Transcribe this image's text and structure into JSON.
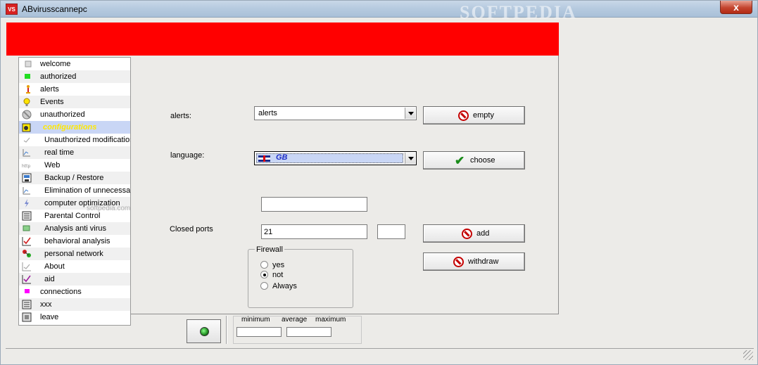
{
  "window": {
    "title": "ABvirusscannepc",
    "app_icon_text": "VS",
    "watermark": "SOFTPEDIA",
    "close_label": "x",
    "banner_color": "#ff0000"
  },
  "sidebar": {
    "items": [
      {
        "label": "welcome",
        "icon": "page-icon"
      },
      {
        "label": "authorized",
        "icon": "green-square-icon"
      },
      {
        "label": "alerts",
        "icon": "alert-figure-icon"
      },
      {
        "label": "Events",
        "icon": "lightbulb-icon"
      },
      {
        "label": "unauthorized",
        "icon": "forbidden-circle-icon"
      },
      {
        "label": "configurations",
        "icon": "config-icon"
      },
      {
        "label": "Unauthorized modification",
        "icon": "checkmark-icon"
      },
      {
        "label": "real time",
        "icon": "chart-icon"
      },
      {
        "label": "Web",
        "icon": "http-icon"
      },
      {
        "label": "Backup / Restore",
        "icon": "backup-icon"
      },
      {
        "label": "Elimination of unnecessary",
        "icon": "chart-icon"
      },
      {
        "label": "computer optimization",
        "icon": "lightning-icon"
      },
      {
        "label": "Parental Control",
        "icon": "list-icon"
      },
      {
        "label": "Analysis anti virus",
        "icon": "green-box-icon"
      },
      {
        "label": "behavioral analysis",
        "icon": "red-check-icon"
      },
      {
        "label": "personal network",
        "icon": "network-icon"
      },
      {
        "label": "About",
        "icon": "checkmark-icon"
      },
      {
        "label": "aid",
        "icon": "purple-check-icon"
      },
      {
        "label": "connections",
        "icon": "magenta-square-icon"
      },
      {
        "label": "xxx",
        "icon": "list-icon"
      },
      {
        "label": "leave",
        "icon": "exit-icon"
      }
    ],
    "watermark": "softpedia.com"
  },
  "form": {
    "alerts_label": "alerts:",
    "alerts_value": "alerts",
    "empty_button": "empty",
    "language_label": "language:",
    "language_value": "GB",
    "choose_button": "choose",
    "blank_field": "",
    "closed_ports_label": "Closed ports",
    "port_value": "21",
    "port_extra": "",
    "add_button": "add",
    "withdraw_button": "withdraw",
    "firewall": {
      "title": "Firewall",
      "options": [
        "yes",
        "not",
        "Always"
      ],
      "selected": "not"
    }
  },
  "meters": {
    "minimum": "minimum",
    "average": "average",
    "maximum": "maximum"
  }
}
